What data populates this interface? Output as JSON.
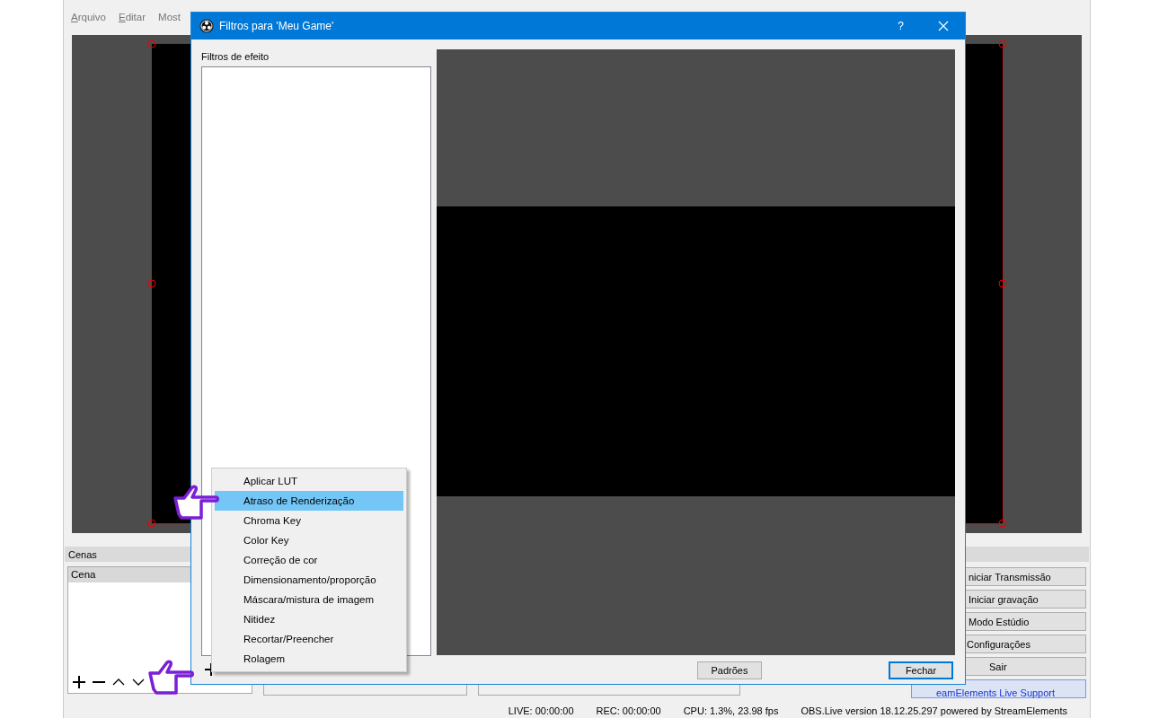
{
  "main_window": {
    "menu": [
      {
        "label": "Arquivo",
        "access_key": true
      },
      {
        "label": "Editar",
        "access_key": true
      },
      {
        "label": "Most",
        "access_key": false
      }
    ],
    "scenes_panel": {
      "title": "Cenas",
      "header": "Cena"
    },
    "controls": [
      {
        "label": "niciar Transmissão",
        "kind": "button"
      },
      {
        "label": "Iniciar gravação",
        "kind": "button"
      },
      {
        "label": "Modo Estúdio",
        "kind": "button"
      },
      {
        "label": "Configurações",
        "kind": "button"
      },
      {
        "label": "Sair",
        "kind": "button"
      },
      {
        "label": "eamElements Live Support",
        "kind": "link"
      }
    ],
    "status_bar": [
      "LIVE: 00:00:00",
      "REC: 00:00:00",
      "CPU: 1.3%, 23.98 fps",
      "OBS.Live version 18.12.25.297 powered by StreamElements"
    ]
  },
  "dialog": {
    "title": "Filtros para 'Meu Game'",
    "help": "?",
    "list_label": "Filtros de efeito",
    "buttons": [
      {
        "label": "Padrões",
        "default": false
      },
      {
        "label": "Fechar",
        "default": true
      }
    ]
  },
  "context_menu": {
    "items": [
      {
        "label": "Aplicar LUT",
        "selected": false
      },
      {
        "label": "Atraso de Renderização",
        "selected": true
      },
      {
        "label": "Chroma Key",
        "selected": false
      },
      {
        "label": "Color Key",
        "selected": false
      },
      {
        "label": "Correção de cor",
        "selected": false
      },
      {
        "label": "Dimensionamento/proporção",
        "selected": false
      },
      {
        "label": "Máscara/mistura de imagem",
        "selected": false
      },
      {
        "label": "Nitidez",
        "selected": false
      },
      {
        "label": "Recortar/Preencher",
        "selected": false
      },
      {
        "label": "Rolagem",
        "selected": false
      }
    ]
  }
}
